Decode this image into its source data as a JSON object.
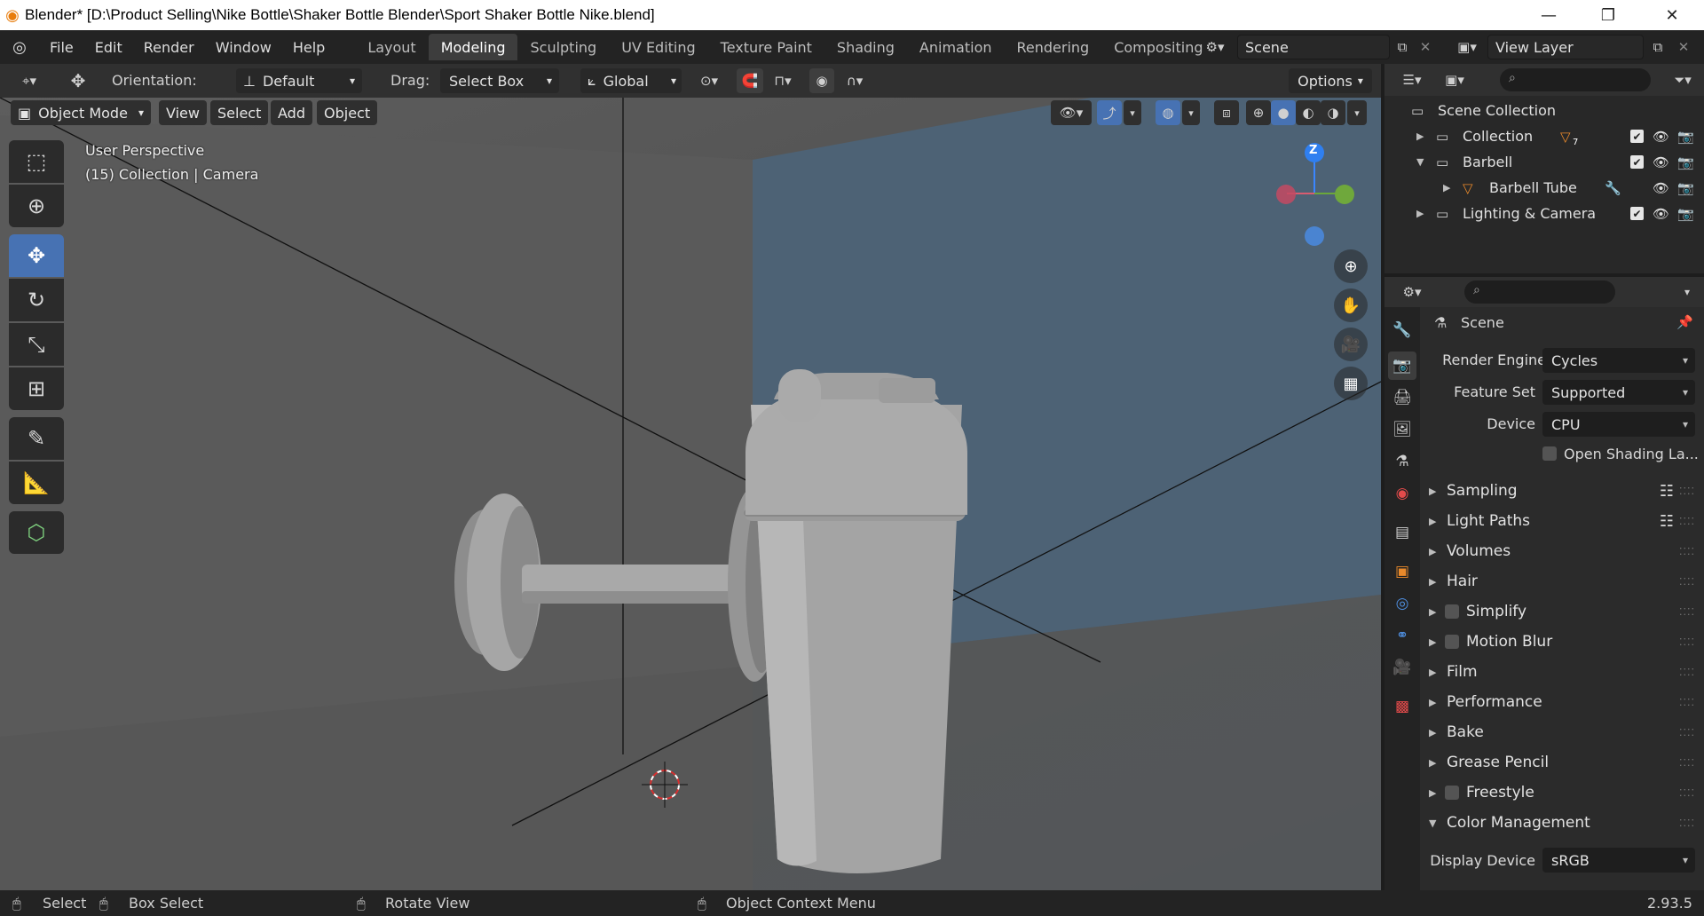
{
  "window": {
    "title": "Blender* [D:\\Product Selling\\Nike Bottle\\Shaker Bottle Blender\\Sport Shaker Bottle Nike.blend]",
    "minimize": "—",
    "restore": "❐",
    "close": "✕"
  },
  "menu": [
    "File",
    "Edit",
    "Render",
    "Window",
    "Help"
  ],
  "workspaces": [
    "Layout",
    "Modeling",
    "Sculpting",
    "UV Editing",
    "Texture Paint",
    "Shading",
    "Animation",
    "Rendering",
    "Compositing"
  ],
  "active_workspace": "Modeling",
  "scene": {
    "name": "Scene",
    "view_layer": "View Layer"
  },
  "viewport_header": {
    "orientation_label": "Orientation:",
    "orientation_value": "Default",
    "drag_label": "Drag:",
    "drag_value": "Select Box",
    "transform_orientation": "Global",
    "options_label": "Options"
  },
  "viewport_sub": {
    "mode": "Object Mode",
    "view": "View",
    "select": "Select",
    "add": "Add",
    "object": "Object"
  },
  "overlay": {
    "perspective": "User Perspective",
    "collection_info": "(15) Collection | Camera"
  },
  "gizmo": {
    "z": "Z"
  },
  "outliner": {
    "root": "Scene Collection",
    "rows": [
      {
        "label": "Collection",
        "badge": "7"
      },
      {
        "label": "Barbell"
      },
      {
        "label": "Barbell Tube"
      },
      {
        "label": "Lighting & Camera"
      }
    ]
  },
  "properties": {
    "context": "Scene",
    "render_engine_label": "Render Engine",
    "render_engine": "Cycles",
    "feature_set_label": "Feature Set",
    "feature_set": "Supported",
    "device_label": "Device",
    "device": "CPU",
    "osl_label": "Open Shading La...",
    "panels": [
      "Sampling",
      "Light Paths",
      "Volumes",
      "Hair",
      "Simplify",
      "Motion Blur",
      "Film",
      "Performance",
      "Bake",
      "Grease Pencil",
      "Freestyle",
      "Color Management"
    ],
    "display_device_label": "Display Device",
    "display_device": "sRGB"
  },
  "statusbar": {
    "select": "Select",
    "box_select": "Box Select",
    "rotate_view": "Rotate View",
    "context_menu": "Object Context Menu",
    "version": "2.93.5"
  },
  "colors": {
    "accent": "#4772b3",
    "viewport_bg": "#535353",
    "header": "#303030"
  }
}
